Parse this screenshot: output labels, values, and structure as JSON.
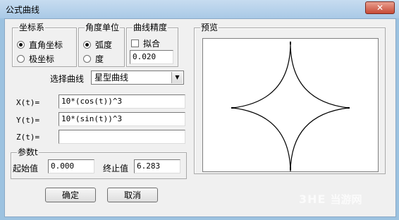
{
  "window": {
    "title": "公式曲线",
    "close_glyph": "✕"
  },
  "coord_group": {
    "legend": "坐标系",
    "options": [
      {
        "label": "直角坐标",
        "selected": true
      },
      {
        "label": "极坐标",
        "selected": false
      }
    ]
  },
  "angle_group": {
    "legend": "角度单位",
    "options": [
      {
        "label": "弧度",
        "selected": true
      },
      {
        "label": "度",
        "selected": false
      }
    ]
  },
  "precision_group": {
    "legend": "曲线精度",
    "fit_label": "拟合",
    "fit_checked": false,
    "precision_value": "0.020"
  },
  "curve_select": {
    "label": "选择曲线",
    "value": "星型曲线"
  },
  "equations": [
    {
      "label": "X(t)=",
      "value": "10*(cos(t))^3"
    },
    {
      "label": "Y(t)=",
      "value": "10*(sin(t))^3"
    },
    {
      "label": "Z(t)=",
      "value": ""
    }
  ],
  "param_group": {
    "legend": "参数t",
    "start_label": "起始值",
    "start_value": "0.000",
    "end_label": "终止值",
    "end_value": "6.283"
  },
  "buttons": {
    "ok": "确定",
    "cancel": "取消"
  },
  "preview": {
    "legend": "预览"
  },
  "watermark": {
    "logo": "3HE",
    "text": "当游网"
  },
  "colors": {
    "title_bar": "#a9c9e6",
    "close_button": "#c74a36",
    "dialog_bg": "#f0f0f0"
  }
}
